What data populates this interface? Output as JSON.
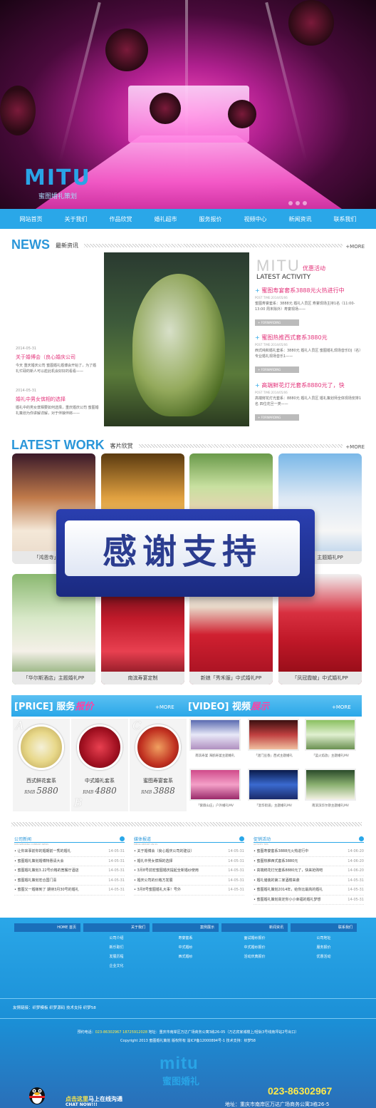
{
  "hero": {
    "logo": "MITU",
    "logo_sub": "蜜图婚礼策划"
  },
  "nav": [
    "网站首页",
    "关于我们",
    "作品欣赏",
    "婚礼超市",
    "服务报价",
    "视频中心",
    "新闻资讯",
    "联系我们"
  ],
  "news": {
    "head_big": "NEWS",
    "head_sub": "最新资讯",
    "more": "+MORE",
    "items": [
      {
        "date": "2014-05-31",
        "title": "关于婚博会（良心婚庆公司",
        "desc": "今天 重庆婚庆公司 蜜图婚礼婚博会开始了，为了婚礼忙碌的新人可以趁此机会好好的看看——"
      },
      {
        "date": "2014-05-31",
        "title": "婚礼中男女傧相的选择",
        "desc": "婚礼中的男女傧相要如何选择，重庆婚庆公司 蜜图婚礼策划为你讲解详解，对于伴娘伴郎——"
      }
    ],
    "activity_logo": "MITU",
    "activity_cn": "优惠活动",
    "activity_en": "LATEST ACTIVITY",
    "activities": [
      {
        "title": "蜜图寿宴套系3888元火热进行中",
        "date": "POST TIME:2014/05/06",
        "desc": "蜜图寿宴套系：3888元 婚礼人员区 寿宴现场主持1名（11:00-13:00 周末除外）寿宴现场——",
        "btn": "+ FORWARDING"
      },
      {
        "title": "蜜图热推西式套系3880元",
        "date": "POST TIME:2014/05/06",
        "desc": "西式纯和婚礼套系：3880元 婚礼人员区 蜜图婚礼现场音乐DJ（名）专业婚礼现场音乐1——",
        "btn": "+ FORWARDING"
      },
      {
        "title": "高端鲜花灯光套系8880元了，快",
        "date": "POST TIME:2014/05/06",
        "desc": "高端鲜花灯光套系：8880元 婚礼人员区 婚礼策划师全体现场安排1名 四位花旦一类——",
        "btn": "+ FORWARDING"
      }
    ]
  },
  "work": {
    "head_big": "LATEST WORK",
    "head_sub": "客片欣赏",
    "more": "+MORE",
    "items": [
      "「鸿恩寺」海鸥照",
      "",
      "",
      "「花园」主题婚礼PP",
      "「华尔斯酒店」主题婚礼PP",
      "南滨寿宴定制",
      "新娘「秀禾服」中式婚礼PP",
      "「凤冠霞帔」中式婚礼PP"
    ],
    "banner": "感谢支持"
  },
  "price": {
    "label": "[PRICE] 服务",
    "label_hl": "报价",
    "more": "+MORE",
    "items": [
      {
        "letter": "A",
        "name": "西式鲜花套系",
        "currency": "RMB",
        "value": "5880"
      },
      {
        "letter": "B",
        "name": "中式婚礼套系",
        "currency": "RMB",
        "value": "4880"
      },
      {
        "letter": "C",
        "name": "蜜图寿宴套系",
        "currency": "RMB",
        "value": "3888"
      }
    ]
  },
  "video": {
    "label": "[VIDEO] 视频",
    "label_hl": "展示",
    "more": "+MORE",
    "items": [
      "南滨寿宴 海鸥寿宴主题婚礼",
      "「迷门豆香」西式主题婚礼",
      "「蓝火焰放」主题婚礼MV",
      "「紫薇山庄」户外婚礼MV",
      "「温华街道」主题婚礼MV",
      "南滨滨华尔斯主题婚礼MV"
    ]
  },
  "lists": [
    {
      "title": "公司新闻",
      "en": "MITUWEDDING COMPANY NEWS",
      "rows": [
        [
          "让你来事前你的婚期前一秀的婚礼",
          "14-05-31"
        ],
        [
          "蜜图婚礼策划婚博特惠请大会",
          "14-05-31"
        ],
        [
          "蜜图婚礼策划3.22号价格的宽餐厅酒店",
          "14-05-31"
        ],
        [
          "蜜图婚礼策划宏合国门喜",
          "14-05-31"
        ],
        [
          "蜜图又一婚嫁到了 期待3月30号的婚礼",
          "14-05-31"
        ]
      ]
    },
    {
      "title": "媒体报道",
      "en": "MEDIA REPORT ON US",
      "rows": [
        [
          "关于婚博会（良心婚庆公司的建议）",
          "14-05-31"
        ],
        [
          "婚礼中男女傧相的选择",
          "14-05-31"
        ],
        [
          "3月8号前宏蜜图婚庆提起全新婚纱使用",
          "14-05-31"
        ],
        [
          "婚庆公司的价格方发展",
          "14-05-31"
        ],
        [
          "3月8号蜜图婚礼大事！号外",
          "14-05-31"
        ]
      ]
    },
    {
      "title": "促销活动",
      "en": "ACTIVITY TIPS",
      "rows": [
        [
          "蜜图寿宴套系3888元火热进行中",
          "14-06-20"
        ],
        [
          "蜜图热推西式套系3880元",
          "14-06-20"
        ],
        [
          "高端鲜花灯光套系8880元了，快来抢购吧",
          "14-06-20"
        ],
        [
          "婚礼储装的第二家酒楼来袭",
          "14-05-31"
        ],
        [
          "蜜图婚礼策划2014年，给你比最高的婚礼",
          "14-05-31"
        ],
        [
          "蜜图婚礼策划高定你小小幸福的婚礼梦想",
          "14-05-31"
        ]
      ]
    }
  ],
  "footer": {
    "cols": [
      {
        "head": "HOME 首页",
        "links": []
      },
      {
        "head": "关于我们",
        "links": [
          "公司介绍",
          "新乐取们",
          "发展历程",
          "企业文化"
        ]
      },
      {
        "head": "案例展示",
        "links": [
          "寿宴套系",
          "中式婚纱",
          "西式婚纱"
        ]
      },
      {
        "head": "新闻资讯",
        "links": [
          "面试婚纱报价",
          "中式婚纱报价",
          "活动庆典报价"
        ]
      },
      {
        "head": "联系我们",
        "links": [
          "公司地址",
          "服务报价",
          "优惠活动"
        ]
      }
    ],
    "friends": "友情链接：织梦模板  织梦源码  技术支持  织梦58",
    "hotline_label": "预约电话：",
    "hotline": "023-86302967 18725912028",
    "addr": "地址：重庆市南岸区万达广场商务公寓3栋26-05（万达宾家城楼上/轻轨3号线南坪站2号出口）",
    "copyright": "Copyright 2013 蜜图婚礼策划 版权所有 渝ICP备12000894号-1 技术支持：织梦58",
    "logo": "mitu",
    "logo_cn": "蜜图婚礼",
    "chat1": "点击这里",
    "chat2": "马上在线沟通",
    "chat3": "CHAT NOW!!!",
    "phone": "023-86302967",
    "address": "地址：重庆市南岸区万达广场商务公寓3栋26-5"
  },
  "colors": {
    "accent": "#2aa7e8",
    "pink": "#e3337a",
    "banner": "#2b3c8f",
    "phone": "#ffe94a"
  }
}
